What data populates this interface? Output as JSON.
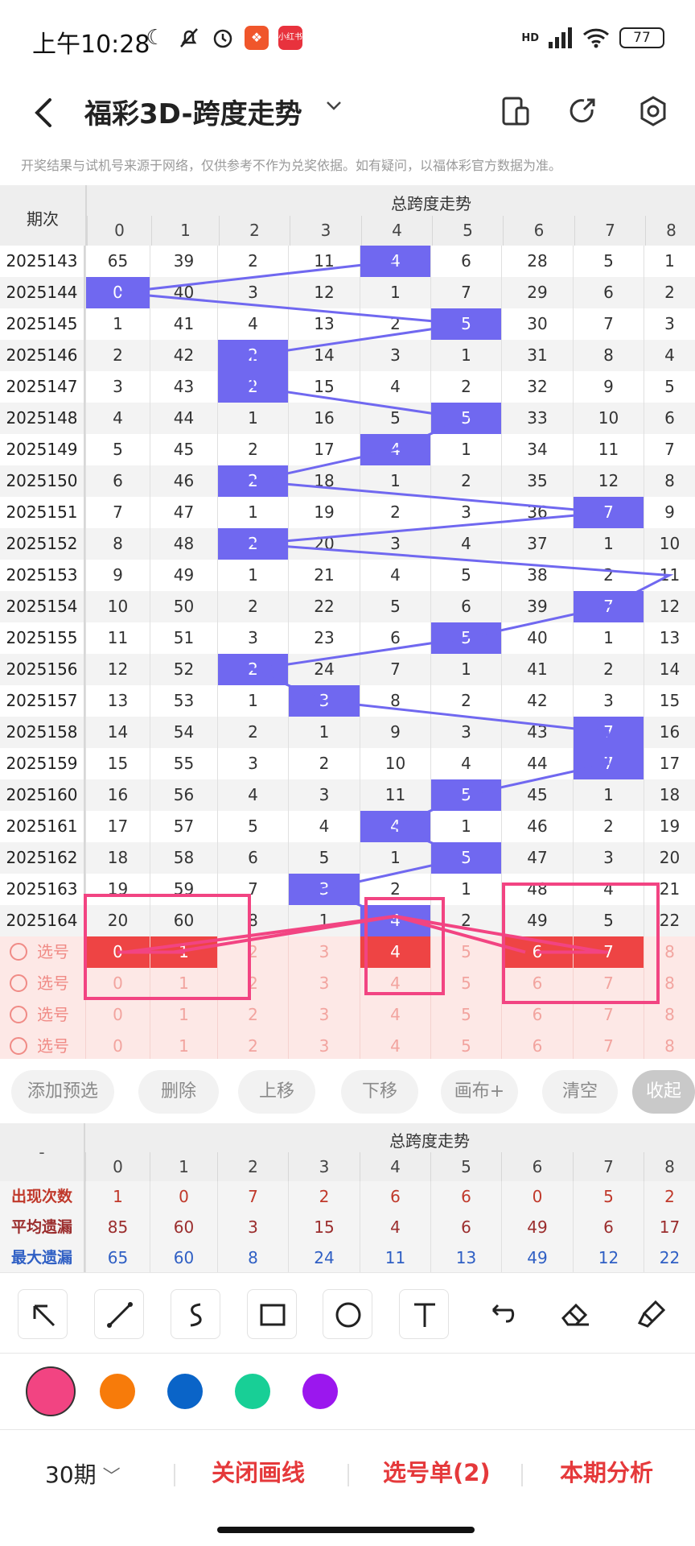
{
  "status_bar": {
    "time": "上午10:28",
    "app_badge_2": "小红书",
    "network": "HD",
    "battery": "77"
  },
  "header": {
    "title": "福彩3D-跨度走势"
  },
  "notice": "开奖结果与试机号来源于网络，仅供参考不作为兑奖依据。如有疑问，以福体彩官方数据为准。",
  "trend_table": {
    "period_header": "期次",
    "group_header": "总跨度走势",
    "columns": [
      "0",
      "1",
      "2",
      "3",
      "4",
      "5",
      "6",
      "7",
      "8"
    ],
    "line_color": "#7068f0",
    "hit_color": "#7068f0",
    "rows": [
      {
        "period": "2025143",
        "values": [
          "65",
          "39",
          "2",
          "11",
          "4",
          "6",
          "28",
          "5",
          "1"
        ],
        "hit": 4
      },
      {
        "period": "2025144",
        "values": [
          "0",
          "40",
          "3",
          "12",
          "1",
          "7",
          "29",
          "6",
          "2"
        ],
        "hit": 0
      },
      {
        "period": "2025145",
        "values": [
          "1",
          "41",
          "4",
          "13",
          "2",
          "5",
          "30",
          "7",
          "3"
        ],
        "hit": 5
      },
      {
        "period": "2025146",
        "values": [
          "2",
          "42",
          "2",
          "14",
          "3",
          "1",
          "31",
          "8",
          "4"
        ],
        "hit": 2
      },
      {
        "period": "2025147",
        "values": [
          "3",
          "43",
          "2",
          "15",
          "4",
          "2",
          "32",
          "9",
          "5"
        ],
        "hit": 2
      },
      {
        "period": "2025148",
        "values": [
          "4",
          "44",
          "1",
          "16",
          "5",
          "5",
          "33",
          "10",
          "6"
        ],
        "hit": 5
      },
      {
        "period": "2025149",
        "values": [
          "5",
          "45",
          "2",
          "17",
          "4",
          "1",
          "34",
          "11",
          "7"
        ],
        "hit": 4
      },
      {
        "period": "2025150",
        "values": [
          "6",
          "46",
          "2",
          "18",
          "1",
          "2",
          "35",
          "12",
          "8"
        ],
        "hit": 2
      },
      {
        "period": "2025151",
        "values": [
          "7",
          "47",
          "1",
          "19",
          "2",
          "3",
          "36",
          "7",
          "9"
        ],
        "hit": 7
      },
      {
        "period": "2025152",
        "values": [
          "8",
          "48",
          "2",
          "20",
          "3",
          "4",
          "37",
          "1",
          "10"
        ],
        "hit": 2
      },
      {
        "period": "2025153",
        "values": [
          "9",
          "49",
          "1",
          "21",
          "4",
          "5",
          "38",
          "2",
          "11"
        ],
        "hit": -1
      },
      {
        "period": "2025154",
        "values": [
          "10",
          "50",
          "2",
          "22",
          "5",
          "6",
          "39",
          "7",
          "12"
        ],
        "hit": 7
      },
      {
        "period": "2025155",
        "values": [
          "11",
          "51",
          "3",
          "23",
          "6",
          "5",
          "40",
          "1",
          "13"
        ],
        "hit": 5
      },
      {
        "period": "2025156",
        "values": [
          "12",
          "52",
          "2",
          "24",
          "7",
          "1",
          "41",
          "2",
          "14"
        ],
        "hit": 2
      },
      {
        "period": "2025157",
        "values": [
          "13",
          "53",
          "1",
          "3",
          "8",
          "2",
          "42",
          "3",
          "15"
        ],
        "hit": 3
      },
      {
        "period": "2025158",
        "values": [
          "14",
          "54",
          "2",
          "1",
          "9",
          "3",
          "43",
          "7",
          "16"
        ],
        "hit": 7
      },
      {
        "period": "2025159",
        "values": [
          "15",
          "55",
          "3",
          "2",
          "10",
          "4",
          "44",
          "7",
          "17"
        ],
        "hit": 7
      },
      {
        "period": "2025160",
        "values": [
          "16",
          "56",
          "4",
          "3",
          "11",
          "5",
          "45",
          "1",
          "18"
        ],
        "hit": 5
      },
      {
        "period": "2025161",
        "values": [
          "17",
          "57",
          "5",
          "4",
          "4",
          "1",
          "46",
          "2",
          "19"
        ],
        "hit": 4
      },
      {
        "period": "2025162",
        "values": [
          "18",
          "58",
          "6",
          "5",
          "1",
          "5",
          "47",
          "3",
          "20"
        ],
        "hit": 5
      },
      {
        "period": "2025163",
        "values": [
          "19",
          "59",
          "7",
          "3",
          "2",
          "1",
          "48",
          "4",
          "21"
        ],
        "hit": 3
      },
      {
        "period": "2025164",
        "values": [
          "20",
          "60",
          "8",
          "1",
          "4",
          "2",
          "49",
          "5",
          "22"
        ],
        "hit": 4
      }
    ],
    "pick_rows": [
      {
        "label": "选号",
        "values": [
          "0",
          "1",
          "2",
          "3",
          "4",
          "5",
          "6",
          "7",
          "8"
        ],
        "selected": [
          0,
          1,
          4,
          6,
          7
        ]
      },
      {
        "label": "选号",
        "values": [
          "0",
          "1",
          "2",
          "3",
          "4",
          "5",
          "6",
          "7",
          "8"
        ],
        "selected": []
      },
      {
        "label": "选号",
        "values": [
          "0",
          "1",
          "2",
          "3",
          "4",
          "5",
          "6",
          "7",
          "8"
        ],
        "selected": []
      },
      {
        "label": "选号",
        "values": [
          "0",
          "1",
          "2",
          "3",
          "4",
          "5",
          "6",
          "7",
          "8"
        ],
        "selected": []
      }
    ]
  },
  "actions": [
    "添加预选",
    "删除",
    "上移",
    "下移",
    "画布+",
    "清空",
    "收起"
  ],
  "stats": {
    "corner": "-",
    "group_header": "总跨度走势",
    "columns": [
      "0",
      "1",
      "2",
      "3",
      "4",
      "5",
      "6",
      "7",
      "8"
    ],
    "rows": [
      {
        "label": "出现次数",
        "values": [
          "1",
          "0",
          "7",
          "2",
          "6",
          "6",
          "0",
          "5",
          "2"
        ],
        "color": "#c0392b"
      },
      {
        "label": "平均遗漏",
        "values": [
          "85",
          "60",
          "3",
          "15",
          "4",
          "6",
          "49",
          "6",
          "17"
        ],
        "color": "#9b2d2d"
      },
      {
        "label": "最大遗漏",
        "values": [
          "65",
          "60",
          "8",
          "24",
          "11",
          "13",
          "49",
          "12",
          "22"
        ],
        "color": "#2f5fc4"
      }
    ]
  },
  "drawing_tools": [
    "arrow-tool",
    "line-tool",
    "curve-tool",
    "rectangle-tool",
    "circle-tool",
    "text-tool",
    "undo-tool",
    "eraser-tool",
    "clear-tool"
  ],
  "colors": [
    "#f24482",
    "#f77b0a",
    "#0a64c8",
    "#18cf96",
    "#9b17ee"
  ],
  "bottom_bar": {
    "period_select": "30期",
    "close_lines": "关闭画线",
    "pick_list": "选号单(2)",
    "analysis": "本期分析"
  }
}
